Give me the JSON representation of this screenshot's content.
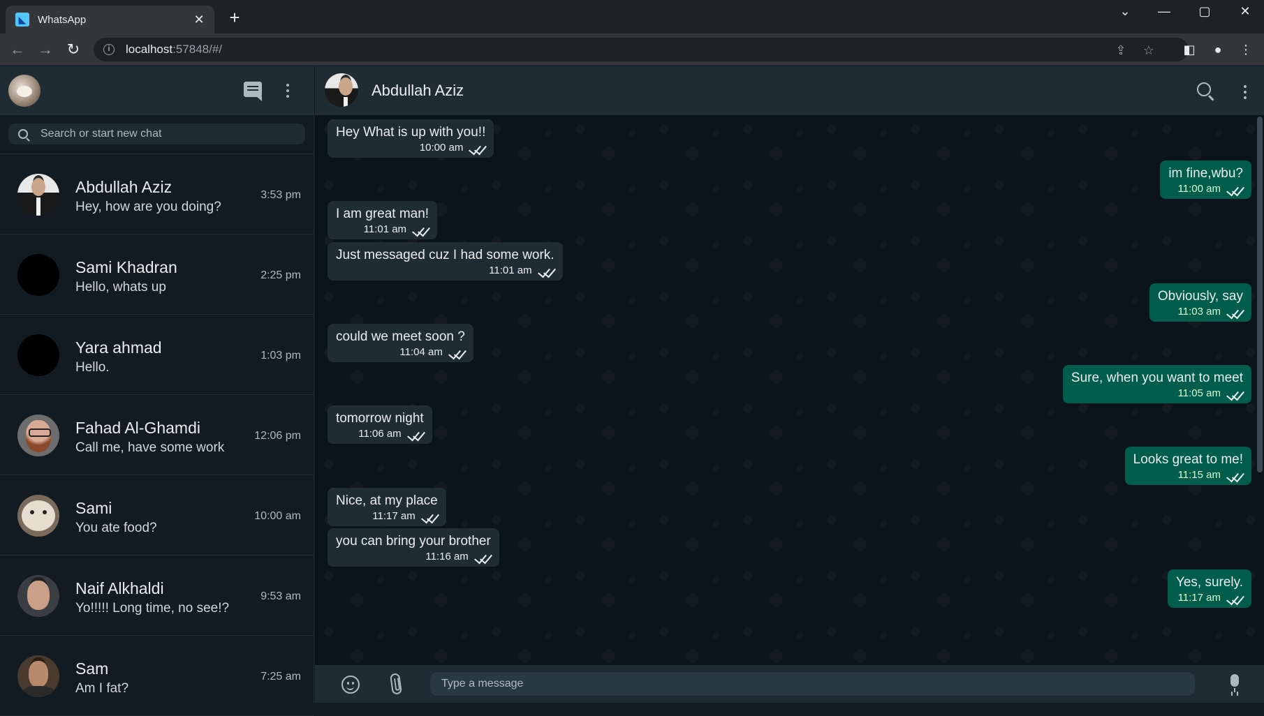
{
  "browser": {
    "tab_title": "WhatsApp",
    "url_host": "localhost",
    "url_path": ":57848/#/"
  },
  "sidebar": {
    "search_placeholder": "Search or start new chat",
    "chats": [
      {
        "name": "Abdullah Aziz",
        "preview": "Hey, how are you doing?",
        "time": "3:53 pm",
        "avatar": "suit"
      },
      {
        "name": "Sami Khadran",
        "preview": "Hello, whats up",
        "time": "2:25 pm",
        "avatar": "black"
      },
      {
        "name": "Yara ahmad",
        "preview": "Hello.",
        "time": "1:03 pm",
        "avatar": "black"
      },
      {
        "name": "Fahad Al-Ghamdi",
        "preview": "Call me, have some work",
        "time": "12:06 pm",
        "avatar": "beard"
      },
      {
        "name": "Sami",
        "preview": "You ate food?",
        "time": "10:00 am",
        "avatar": "cat"
      },
      {
        "name": "Naif Alkhaldi",
        "preview": "Yo!!!!! Long time, no see!?",
        "time": "9:53 am",
        "avatar": "man"
      },
      {
        "name": "Sam",
        "preview": "Am I fat?",
        "time": "7:25 am",
        "avatar": "man2"
      }
    ]
  },
  "conversation": {
    "name": "Abdullah Aziz",
    "compose_placeholder": "Type a message",
    "messages": [
      {
        "dir": "in",
        "text": "Hey What is up with you!!",
        "time": "10:00 am"
      },
      {
        "dir": "out",
        "text": "im fine,wbu?",
        "time": "11:00 am"
      },
      {
        "dir": "in",
        "text": "I am great man!",
        "time": "11:01 am"
      },
      {
        "dir": "in",
        "text": "Just messaged cuz I had some work.",
        "time": "11:01 am"
      },
      {
        "dir": "out",
        "text": "Obviously, say",
        "time": "11:03 am"
      },
      {
        "dir": "in",
        "text": "could we meet soon ?",
        "time": "11:04 am"
      },
      {
        "dir": "out",
        "text": "Sure, when you want to meet",
        "time": "11:05 am"
      },
      {
        "dir": "in",
        "text": "tomorrow night",
        "time": "11:06 am"
      },
      {
        "dir": "out",
        "text": "Looks great to me!",
        "time": "11:15 am"
      },
      {
        "dir": "in",
        "text": "Nice, at my place",
        "time": "11:17 am"
      },
      {
        "dir": "in",
        "text": "you can bring your brother",
        "time": "11:16 am"
      },
      {
        "dir": "out",
        "text": "Yes, surely.",
        "time": "11:17 am"
      }
    ]
  },
  "colors": {
    "incoming_bubble": "#202c33",
    "outgoing_bubble": "#005c4b",
    "background": "#0b141a",
    "header": "#202c33"
  }
}
